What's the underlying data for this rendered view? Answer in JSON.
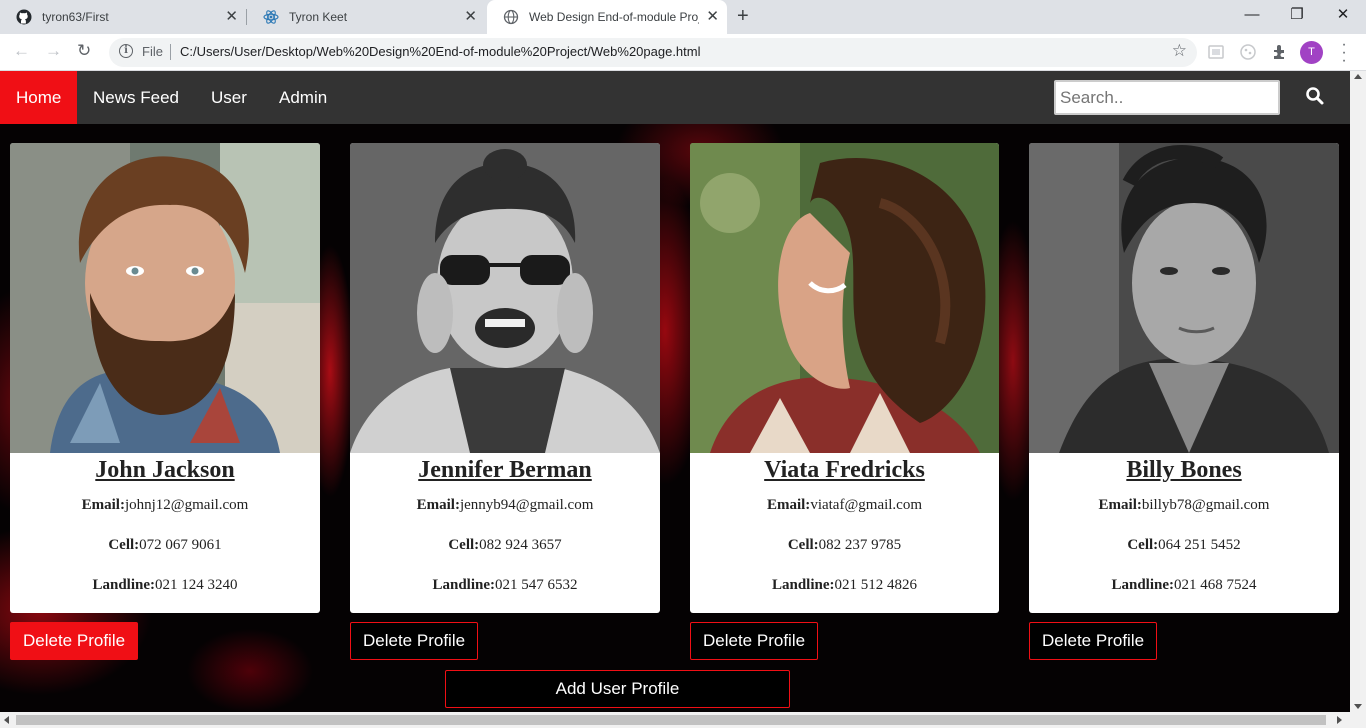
{
  "browser": {
    "tabs": [
      {
        "title": "tyron63/First",
        "favicon": "github-icon"
      },
      {
        "title": "Tyron Keet",
        "favicon": "react-icon"
      },
      {
        "title": "Web Design End-of-module Proj",
        "favicon": "globe-icon"
      }
    ],
    "address": {
      "scheme_label": "File",
      "url": "C:/Users/User/Desktop/Web%20Design%20End-of-module%20Project/Web%20page.html"
    },
    "profile_initial": "T"
  },
  "nav": {
    "items": [
      {
        "label": "Home",
        "active": true
      },
      {
        "label": "News Feed",
        "active": false
      },
      {
        "label": "User",
        "active": false
      },
      {
        "label": "Admin",
        "active": false
      }
    ],
    "search_placeholder": "Search.."
  },
  "profiles": [
    {
      "name": "John Jackson",
      "email_label": "Email:",
      "email": "johnj12@gmail.com",
      "cell_label": "Cell:",
      "cell": "072 067 9061",
      "landline_label": "Landline:",
      "landline": "021 124 3240",
      "delete_label": "Delete Profile"
    },
    {
      "name": "Jennifer Berman",
      "email_label": "Email:",
      "email": "jennyb94@gmail.com",
      "cell_label": "Cell:",
      "cell": "082 924 3657",
      "landline_label": "Landline:",
      "landline": "021 547 6532",
      "delete_label": "Delete Profile"
    },
    {
      "name": "Viata Fredricks",
      "email_label": "Email:",
      "email": "viataf@gmail.com",
      "cell_label": "Cell:",
      "cell": "082 237 9785",
      "landline_label": "Landline:",
      "landline": "021 512 4826",
      "delete_label": "Delete Profile"
    },
    {
      "name": "Billy Bones",
      "email_label": "Email:",
      "email": "billyb78@gmail.com",
      "cell_label": "Cell:",
      "cell": "064 251 5452",
      "landline_label": "Landline:",
      "landline": "021 468 7524",
      "delete_label": "Delete Profile"
    }
  ],
  "add_profile_label": "Add User Profile",
  "colors": {
    "accent_red": "#f00f15",
    "nav_bg": "#333333",
    "profile_avatar": "#a142c4"
  }
}
